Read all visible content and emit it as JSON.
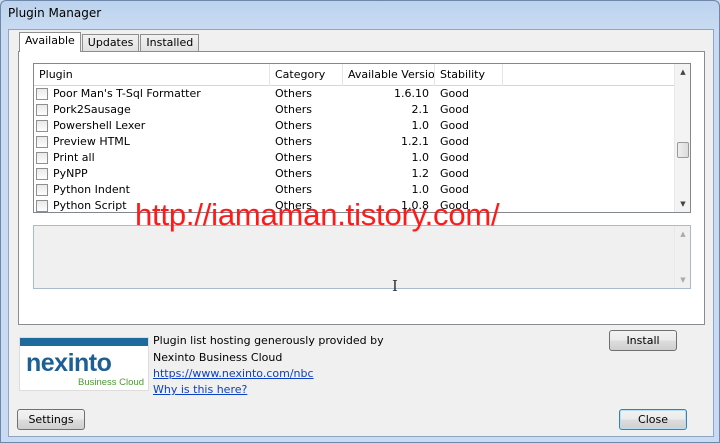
{
  "window": {
    "title": "Plugin Manager"
  },
  "tabs": [
    "Available",
    "Updates",
    "Installed"
  ],
  "columns": {
    "plugin": "Plugin",
    "category": "Category",
    "version": "Available Version",
    "stability": "Stability"
  },
  "plugins": [
    {
      "name": "Poor Man's T-Sql Formatter",
      "category": "Others",
      "version": "1.6.10",
      "stability": "Good"
    },
    {
      "name": "Pork2Sausage",
      "category": "Others",
      "version": "2.1",
      "stability": "Good"
    },
    {
      "name": "Powershell Lexer",
      "category": "Others",
      "version": "1.0",
      "stability": "Good"
    },
    {
      "name": "Preview HTML",
      "category": "Others",
      "version": "1.2.1",
      "stability": "Good"
    },
    {
      "name": "Print all",
      "category": "Others",
      "version": "1.0",
      "stability": "Good"
    },
    {
      "name": "PyNPP",
      "category": "Others",
      "version": "1.2",
      "stability": "Good"
    },
    {
      "name": "Python Indent",
      "category": "Others",
      "version": "1.0",
      "stability": "Good"
    },
    {
      "name": "Python Script",
      "category": "Others",
      "version": "1.0.8",
      "stability": "Good"
    }
  ],
  "watermark": "http://iamaman.tistory.com/",
  "buttons": {
    "install": "Install",
    "settings": "Settings",
    "close": "Close"
  },
  "hosting": {
    "line1": "Plugin list hosting generously provided by",
    "line2": "Nexinto Business Cloud",
    "url": "https://www.nexinto.com/nbc",
    "why": "Why is this here?"
  },
  "logo": {
    "word": "nexinto",
    "tagline": "Business Cloud"
  },
  "icons": {
    "scroll_up": "scroll-up-arrow-icon",
    "scroll_down": "scroll-down-arrow-icon",
    "cursor": "text-cursor-icon"
  }
}
